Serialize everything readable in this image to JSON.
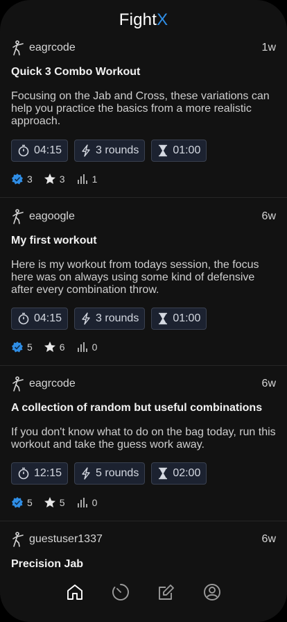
{
  "app": {
    "logo_main": "Fight",
    "logo_accent": "X",
    "accent_color": "#2f8ee6"
  },
  "feed": [
    {
      "author": "eagrcode",
      "age": "1w",
      "title": "Quick 3 Combo Workout",
      "description": "Focusing on the Jab and Cross, these variations can help you practice the basics from a more realistic approach.",
      "duration": "04:15",
      "rounds": "3 rounds",
      "rest": "01:00",
      "badge_count": "3",
      "star_count": "3",
      "stat_count": "1"
    },
    {
      "author": "eagoogle",
      "age": "6w",
      "title": "My first workout",
      "description": "Here is my workout from todays session, the focus here was on always using some kind of defensive after every combination throw.",
      "duration": "04:15",
      "rounds": "3 rounds",
      "rest": "01:00",
      "badge_count": "5",
      "star_count": "6",
      "stat_count": "0"
    },
    {
      "author": "eagrcode",
      "age": "6w",
      "title": "A collection of random but useful combinations",
      "description": "If you don't know what to do on the bag today, run this workout and take the guess work away.",
      "duration": "12:15",
      "rounds": "5 rounds",
      "rest": "02:00",
      "badge_count": "5",
      "star_count": "5",
      "stat_count": "0"
    },
    {
      "author": "guestuser1337",
      "age": "6w",
      "title": "Precision Jab"
    }
  ],
  "tabs": [
    {
      "icon": "home-icon"
    },
    {
      "icon": "timer-icon"
    },
    {
      "icon": "edit-icon"
    },
    {
      "icon": "profile-icon"
    }
  ]
}
